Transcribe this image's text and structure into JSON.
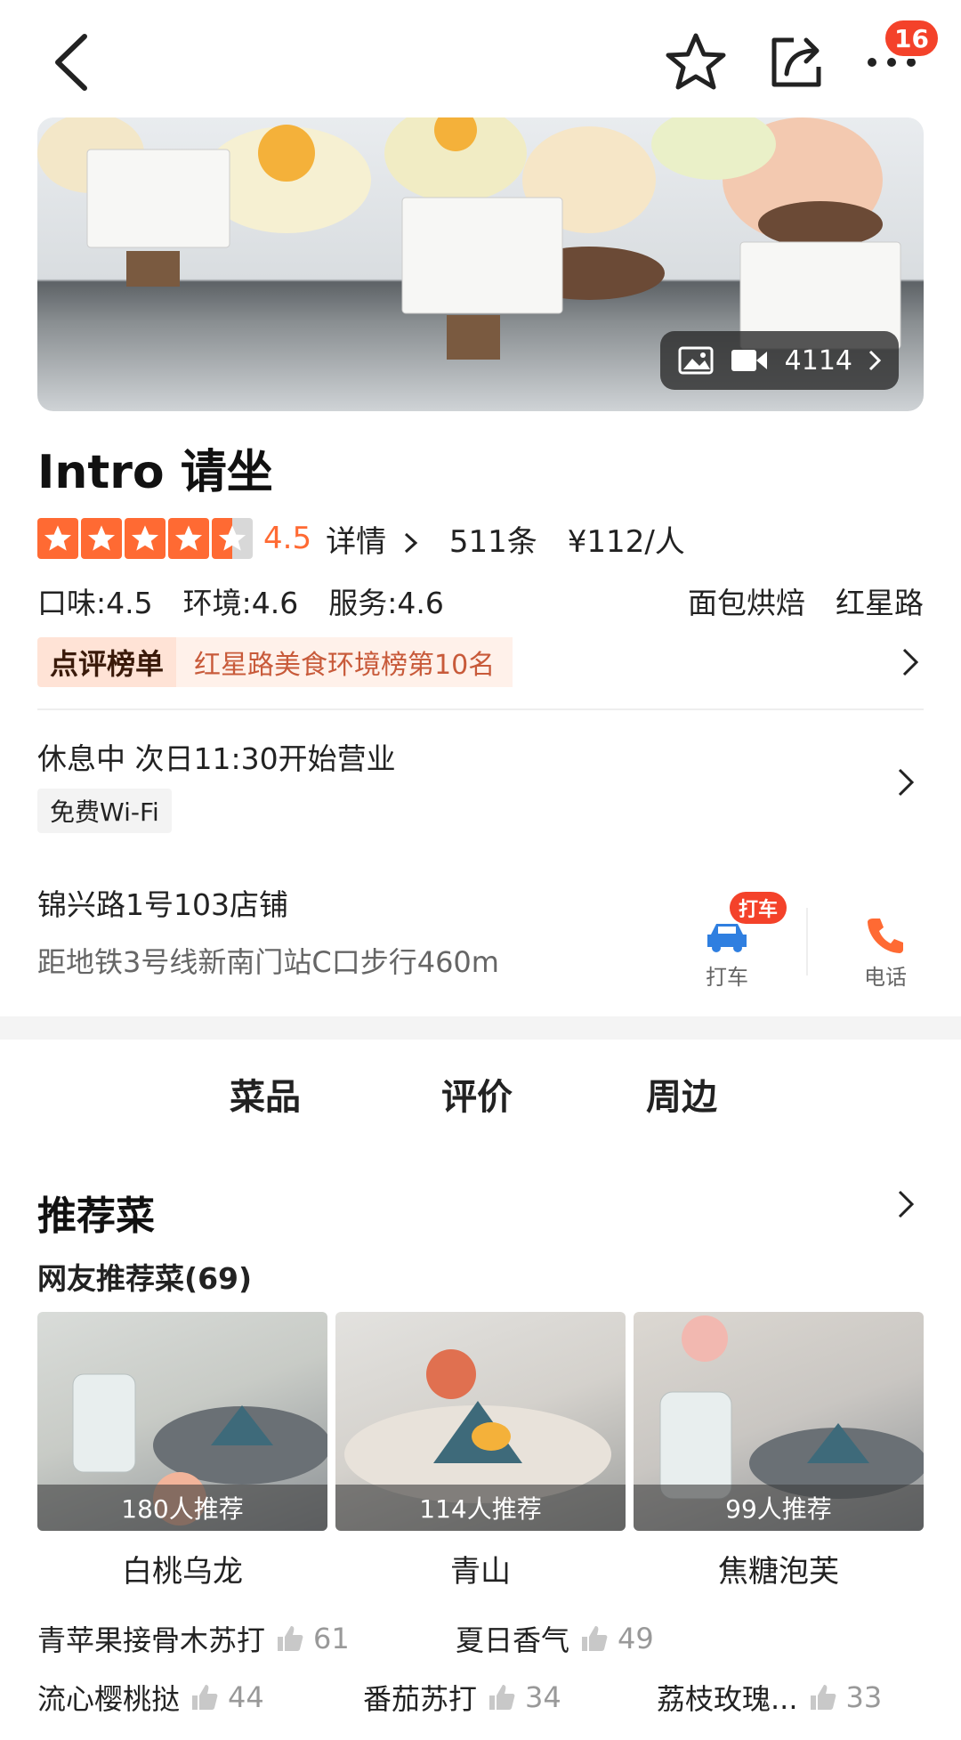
{
  "header": {
    "back_icon": "chevron-left-icon",
    "favorite_icon": "star-outline-icon",
    "share_icon": "share-icon",
    "more_icon": "more-dots-icon",
    "notification_badge": "16"
  },
  "hero": {
    "media_count": "4114"
  },
  "shop": {
    "name": "Intro 请坐",
    "rating": "4.5",
    "rating_value": 4.5,
    "details_label": "详情",
    "review_count": "511条",
    "price": "¥112/人",
    "taste": "口味:4.5",
    "environment": "环境:4.6",
    "service": "服务:4.6",
    "category": "面包烘焙",
    "area": "红星路",
    "rank_tag": "点评榜单",
    "rank_text": "红星路美食环境榜第10名",
    "status": "休息中 次日11:30开始营业",
    "wifi": "免费Wi-Fi",
    "address": "锦兴路1号103店铺",
    "distance": "距地铁3号线新南门站C口步行460m",
    "taxi_label": "打车",
    "taxi_badge": "打车",
    "phone_label": "电话"
  },
  "tabs": [
    {
      "label": "菜品",
      "active": true
    },
    {
      "label": "评价",
      "active": false
    },
    {
      "label": "周边",
      "active": false
    }
  ],
  "recommend": {
    "title": "推荐菜",
    "subtitle": "网友推荐菜(69)",
    "dishes": [
      {
        "name": "白桃乌龙",
        "count": "180人推荐"
      },
      {
        "name": "青山",
        "count": "114人推荐"
      },
      {
        "name": "焦糖泡芙",
        "count": "99人推荐"
      }
    ],
    "tags": [
      {
        "name": "青苹果接骨木苏打",
        "likes": "61"
      },
      {
        "name": "夏日香气",
        "likes": "49"
      },
      {
        "name": "流心樱桃挞",
        "likes": "44"
      },
      {
        "name": "番茄苏打",
        "likes": "34"
      },
      {
        "name": "荔枝玫瑰...",
        "likes": "33"
      }
    ]
  },
  "colors": {
    "accent": "#ff6a33",
    "badge": "#f4422a"
  }
}
